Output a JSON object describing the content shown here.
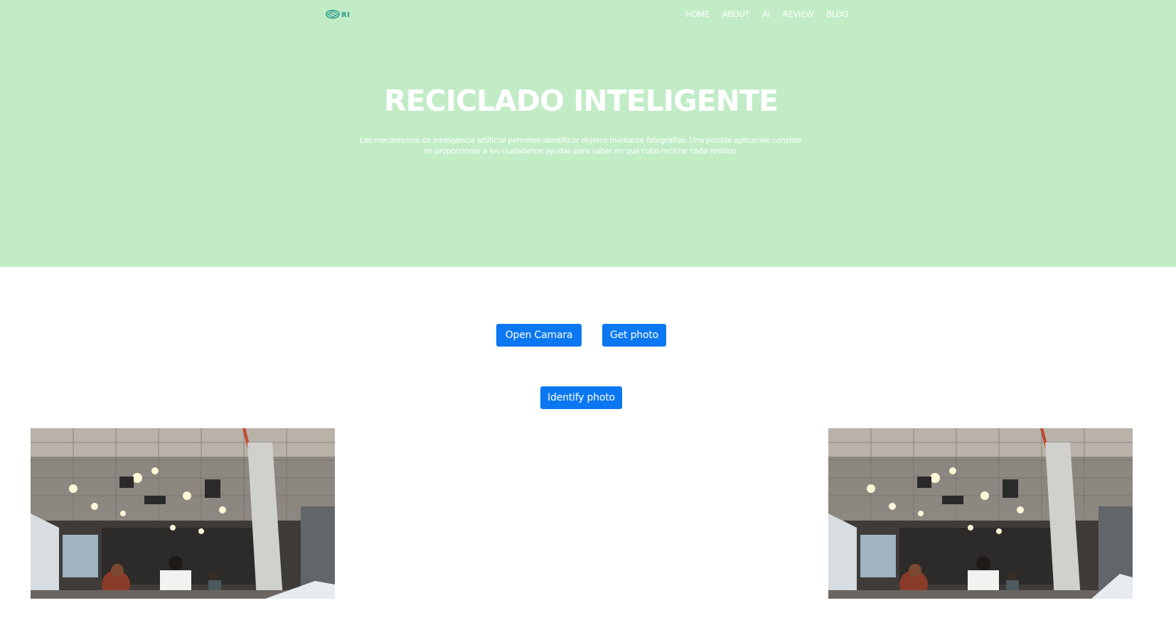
{
  "brand": {
    "logo_text": "RI"
  },
  "nav": {
    "items": [
      {
        "label": "HOME"
      },
      {
        "label": "ABOUT"
      },
      {
        "label": "AI"
      },
      {
        "label": "REVIEW"
      },
      {
        "label": "BLOG"
      }
    ]
  },
  "hero": {
    "title": "RECICLADO INTELIGENTE",
    "description": "Los mecanismos de inteligencia artificial permiten identificar objetos mediante fotografías. Una posible aplicación consiste en proporcionar a los ciudadanos ayudas para saber en qué cubo reciclar cada residuo."
  },
  "actions": {
    "open_camera_label": "Open Camara",
    "get_photo_label": "Get photo",
    "identify_photo_label": "Identify photo"
  },
  "colors": {
    "hero_background": "#c1ecc6",
    "button_background": "#0b78f2",
    "logo_accent": "#2a9d8f"
  },
  "icons": {
    "logo": "recycle-bin-logo-icon"
  }
}
